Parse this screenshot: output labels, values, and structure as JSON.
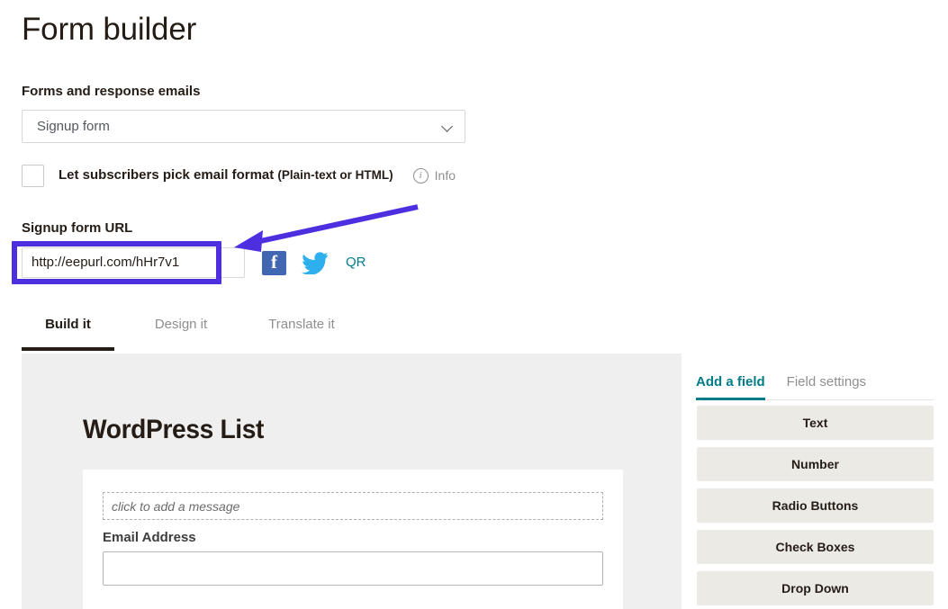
{
  "page": {
    "title": "Form builder"
  },
  "forms_section": {
    "label": "Forms and response emails",
    "select": {
      "value": "Signup form",
      "options": [
        "Signup form"
      ],
      "chevron_icon": "chevron-down-icon"
    }
  },
  "email_format": {
    "checkbox_checked": false,
    "label_main": "Let subscribers pick email format ",
    "label_sub": "(Plain-text or HTML)",
    "info_glyph": "i",
    "info_label": "Info"
  },
  "signup_url": {
    "label": "Signup form URL",
    "value": "http://eepurl.com/hHr7v1",
    "placeholder": "http://eepurl.com/",
    "highlight_color": "#4d2fe0"
  },
  "share": {
    "facebook_glyph": "f",
    "facebook_color": "#4267b2",
    "twitter_name": "twitter-bird-icon",
    "twitter_color": "#2fb0ee",
    "qr_label": "QR",
    "qr_color": "#007c89"
  },
  "annotation": {
    "arrow_color": "#4d2fe0"
  },
  "tabs": [
    {
      "label": "Build it",
      "active": true
    },
    {
      "label": "Design it",
      "active": false
    },
    {
      "label": "Translate it",
      "active": false
    }
  ],
  "preview": {
    "list_title": "WordPress List",
    "message_placeholder": "click to add a message",
    "email_field": {
      "label": "Email Address",
      "value": ""
    }
  },
  "fields_panel": {
    "tabs": [
      {
        "label": "Add a field",
        "active": true
      },
      {
        "label": "Field settings",
        "active": false
      }
    ],
    "accent_color": "#007c89",
    "buttons": [
      {
        "label": "Text"
      },
      {
        "label": "Number"
      },
      {
        "label": "Radio Buttons"
      },
      {
        "label": "Check Boxes"
      },
      {
        "label": "Drop Down"
      }
    ]
  }
}
